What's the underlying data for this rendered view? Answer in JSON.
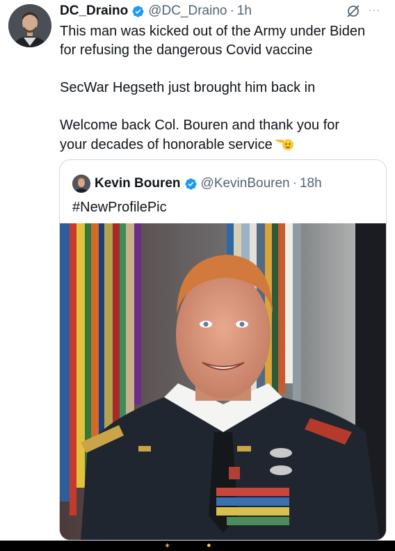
{
  "tweet": {
    "author_name": "DC_Draino",
    "author_handle": "@DC_Draino",
    "separator": "·",
    "time": "1h",
    "avatar_icon": "user-avatar",
    "verified_icon": "verified-badge-icon",
    "actions": {
      "grok_icon": "grok-icon",
      "more_icon": "more-options-icon",
      "more_label": "···"
    },
    "lines": [
      "This man was kicked out of the Army under Biden",
      "for refusing the dangerous Covid vaccine",
      "SecWar Hegseth just brought him back in",
      "Welcome back Col. Bouren and thank you for",
      "your decades of honorable service"
    ],
    "emoji_icon": "salute-emoji-icon"
  },
  "quoted_tweet": {
    "author_name": "Kevin Bouren",
    "author_handle": "@KevinBouren",
    "separator": "·",
    "time": "18h",
    "text": "#NewProfilePic",
    "photo_icon": "profile-photo"
  },
  "colors": {
    "text_primary": "#0f1419",
    "text_secondary": "#536471",
    "verified_blue": "#1d9bf0",
    "border": "#cfd9de"
  }
}
